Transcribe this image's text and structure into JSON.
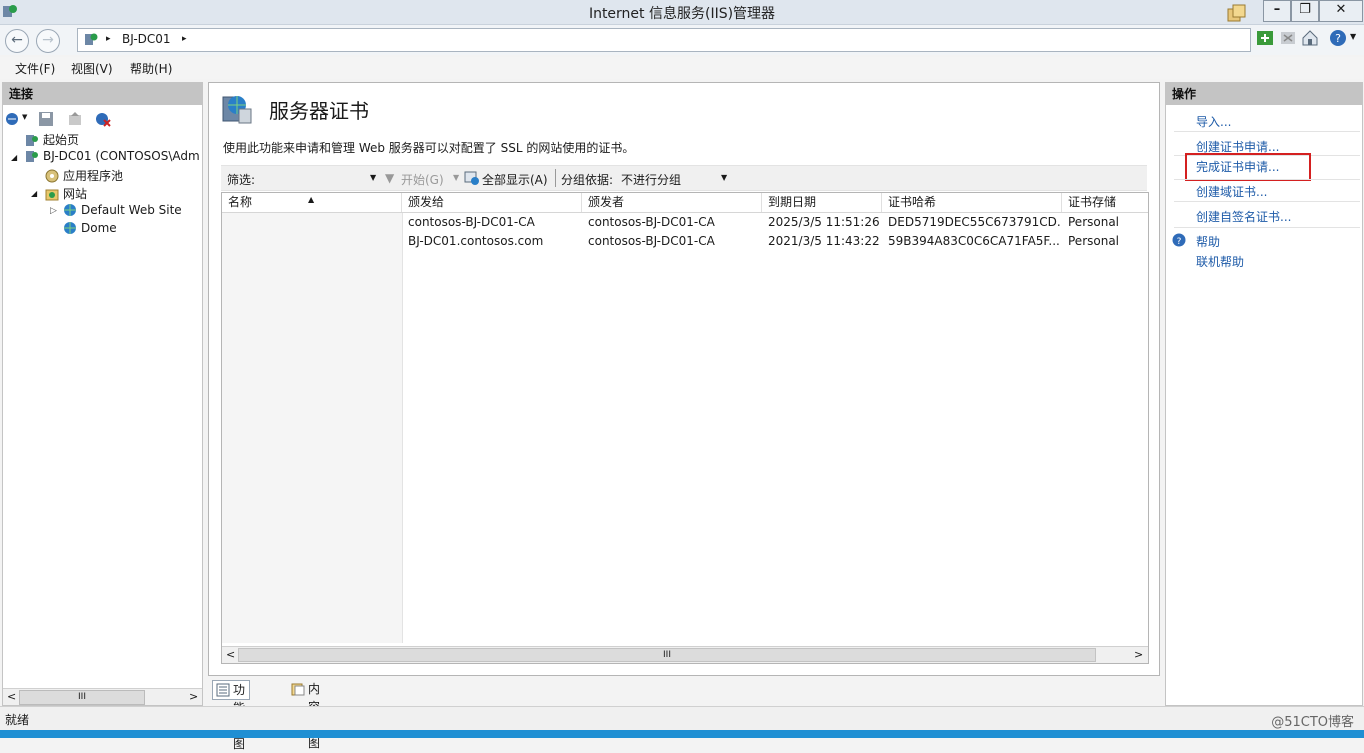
{
  "window": {
    "title": "Internet 信息服务(IIS)管理器",
    "minimize": "–",
    "restore": "❐",
    "close": "✕"
  },
  "address": {
    "segment_arrow_1": "▸",
    "server": "BJ-DC01",
    "segment_arrow_2": "▸"
  },
  "menu": [
    "文件(F)",
    "视图(V)",
    "帮助(H)"
  ],
  "connections": {
    "header": "连接",
    "tree": [
      {
        "label": "起始页",
        "icon": "home-page-icon"
      },
      {
        "label": "BJ-DC01 (CONTOSOS\\Adm",
        "icon": "server-icon"
      },
      {
        "label": "应用程序池",
        "icon": "app-pool-icon"
      },
      {
        "label": "网站",
        "icon": "sites-folder-icon"
      },
      {
        "label": "Default Web Site",
        "icon": "globe-icon"
      },
      {
        "label": "Dome",
        "icon": "globe-icon"
      }
    ],
    "scroll_grip": "III"
  },
  "main": {
    "title": "服务器证书",
    "description": "使用此功能来申请和管理 Web 服务器可以对配置了 SSL 的网站使用的证书。",
    "filter": {
      "label": "筛选:",
      "start": "开始(G)",
      "show_all": "全部显示(A)",
      "group_by_label": "分组依据:",
      "group_by_value": "不进行分组"
    },
    "columns": [
      "名称",
      "颁发给",
      "颁发者",
      "到期日期",
      "证书哈希",
      "证书存储"
    ],
    "rows": [
      [
        "",
        "contosos-BJ-DC01-CA",
        "contosos-BJ-DC01-CA",
        "2025/3/5 11:51:26",
        "DED5719DEC55C673791CD...",
        "Personal"
      ],
      [
        "",
        "BJ-DC01.contosos.com",
        "contosos-BJ-DC01-CA",
        "2021/3/5 11:43:22",
        "59B394A83C0C6CA71FA5F...",
        "Personal"
      ]
    ],
    "scroll_grip": "III",
    "tabs": {
      "features_view": "功能视图",
      "content_view": "内容视图"
    }
  },
  "actions": {
    "header": "操作",
    "items": [
      "导入...",
      "创建证书申请...",
      "完成证书申请...",
      "创建域证书...",
      "创建自签名证书..."
    ],
    "help": "帮助",
    "online_help": "联机帮助"
  },
  "status": {
    "text": "就绪",
    "watermark": "@51CTO博客"
  },
  "colors": {
    "link": "#1e5ba8",
    "highlight_box": "#d42020",
    "taskbar": "#1f8fd3"
  }
}
